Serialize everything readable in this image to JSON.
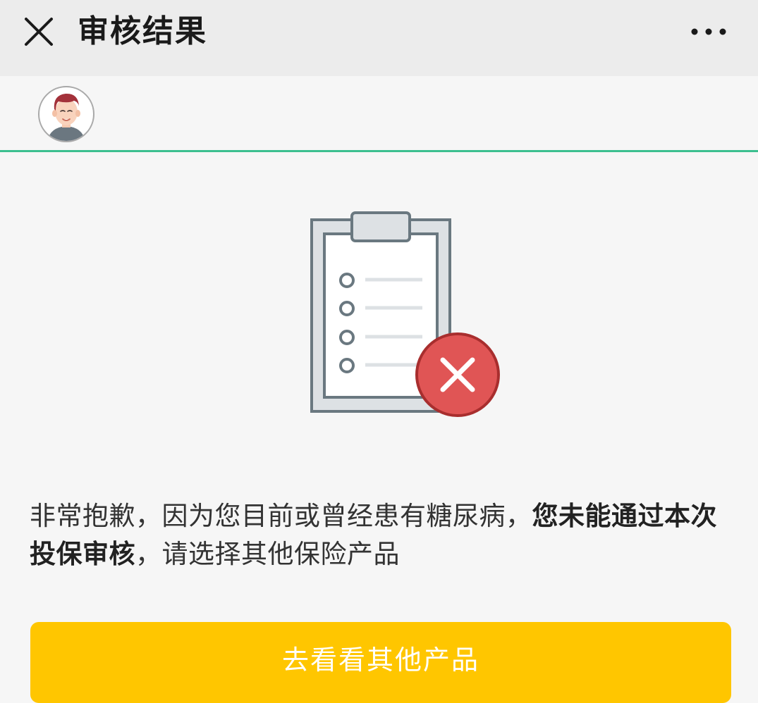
{
  "header": {
    "title": "审核结果",
    "close_icon": "close-icon",
    "more_icon": "more-dots-icon"
  },
  "user": {
    "avatar_icon": "user-avatar-icon"
  },
  "result": {
    "illustration_icon": "clipboard-rejected-icon",
    "message_prefix": "非常抱歉，因为您目前或曾经患有糖尿病，",
    "message_bold": "您未能通过本次投保审核",
    "message_suffix": "，请选择其他保险产品"
  },
  "actions": {
    "primary_label": "去看看其他产品"
  },
  "colors": {
    "accent_line": "#3cbf8f",
    "button": "#ffc600",
    "error": "#e05555"
  }
}
